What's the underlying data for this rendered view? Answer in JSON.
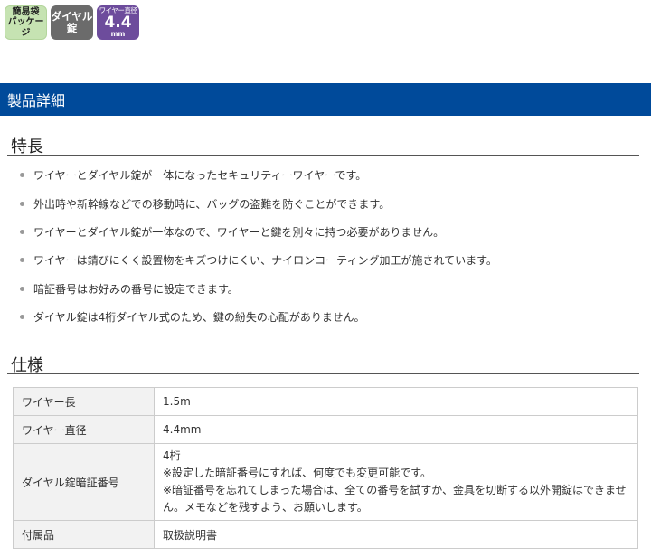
{
  "badges": {
    "simple_bag": [
      "簡易袋",
      "パッケージ"
    ],
    "dial_lock": [
      "ダイヤル",
      "錠"
    ],
    "wire_diameter": {
      "label": "ワイヤー直径",
      "value": "4.4",
      "unit": "mm"
    }
  },
  "detail_header": "製品詳細",
  "features": {
    "title": "特長",
    "items": [
      "ワイヤーとダイヤル錠が一体になったセキュリティーワイヤーです。",
      "外出時や新幹線などでの移動時に、バッグの盗難を防ぐことができます。",
      "ワイヤーとダイヤル錠が一体なので、ワイヤーと鍵を別々に持つ必要がありません。",
      "ワイヤーは錆びにくく設置物をキズつけにくい、ナイロンコーティング加工が施されています。",
      "暗証番号はお好みの番号に設定できます。",
      "ダイヤル錠は4桁ダイヤル式のため、鍵の紛失の心配がありません。"
    ]
  },
  "specs": {
    "title": "仕様",
    "rows": [
      {
        "label": "ワイヤー長",
        "value": [
          "1.5m"
        ]
      },
      {
        "label": "ワイヤー直径",
        "value": [
          "4.4mm"
        ]
      },
      {
        "label": "ダイヤル錠暗証番号",
        "value": [
          "4桁",
          "※設定した暗証番号にすれば、何度でも変更可能です。",
          "※暗証番号を忘れてしまった場合は、全ての番号を試すか、金具を切断する以外開錠はできませ",
          "ん。メモなどを残すよう、お願いします。"
        ]
      },
      {
        "label": "付属品",
        "value": [
          "取扱説明書"
        ]
      }
    ]
  }
}
